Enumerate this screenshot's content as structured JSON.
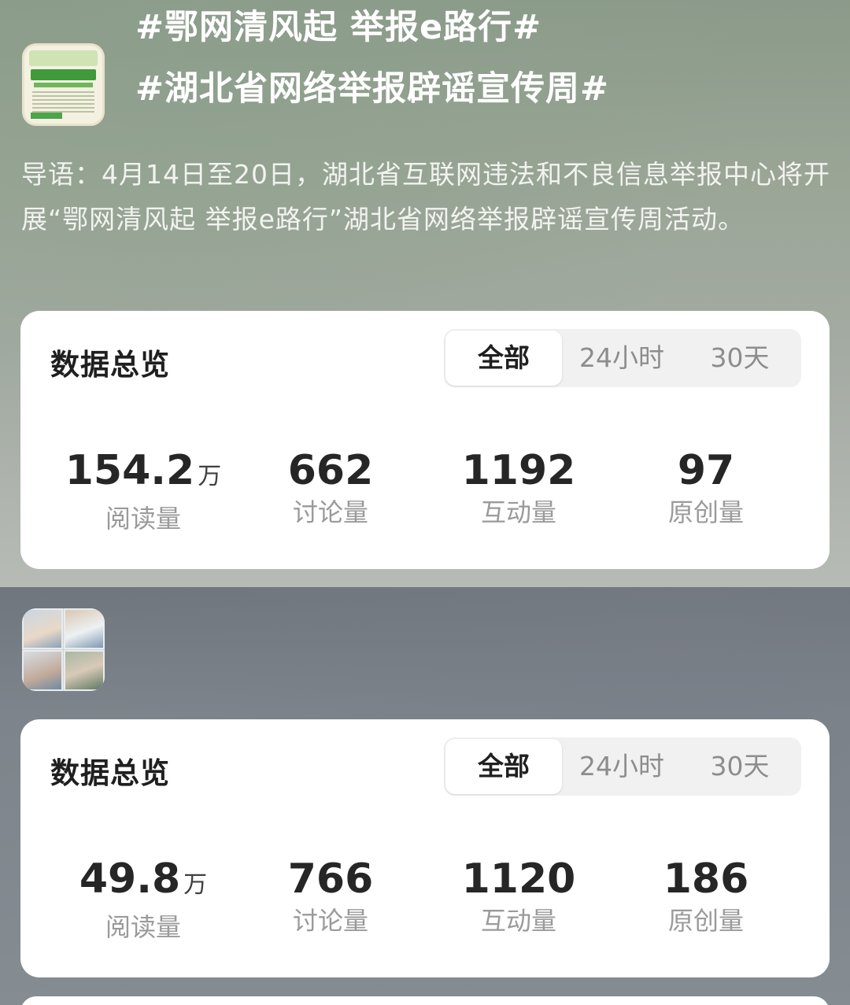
{
  "topics": [
    {
      "title": "#湖北省网络举报辟谣宣传周#",
      "thumbnail_icon": "campaign-poster-thumbnail",
      "intro": "导语：4月14日至20日，湖北省互联网违法和不良信息举报中心将开展“鄂网清风起 举报e路行”湖北省网络举报辟谣宣传周活动。",
      "overview": {
        "title": "数据总览",
        "tabs": [
          "全部",
          "24小时",
          "30天"
        ],
        "active_tab": "全部",
        "stats": [
          {
            "value": "154.2",
            "unit": "万",
            "label": "阅读量"
          },
          {
            "value": "662",
            "unit": "",
            "label": "讨论量"
          },
          {
            "value": "1192",
            "unit": "",
            "label": "互动量"
          },
          {
            "value": "97",
            "unit": "",
            "label": "原创量"
          }
        ]
      }
    },
    {
      "title": "#鄂网清风起 举报e路行#",
      "thumbnail_icon": "event-photos-thumbnail",
      "overview": {
        "title": "数据总览",
        "tabs": [
          "全部",
          "24小时",
          "30天"
        ],
        "active_tab": "全部",
        "stats": [
          {
            "value": "49.8",
            "unit": "万",
            "label": "阅读量"
          },
          {
            "value": "766",
            "unit": "",
            "label": "讨论量"
          },
          {
            "value": "1120",
            "unit": "",
            "label": "互动量"
          },
          {
            "value": "186",
            "unit": "",
            "label": "原创量"
          }
        ]
      }
    }
  ]
}
